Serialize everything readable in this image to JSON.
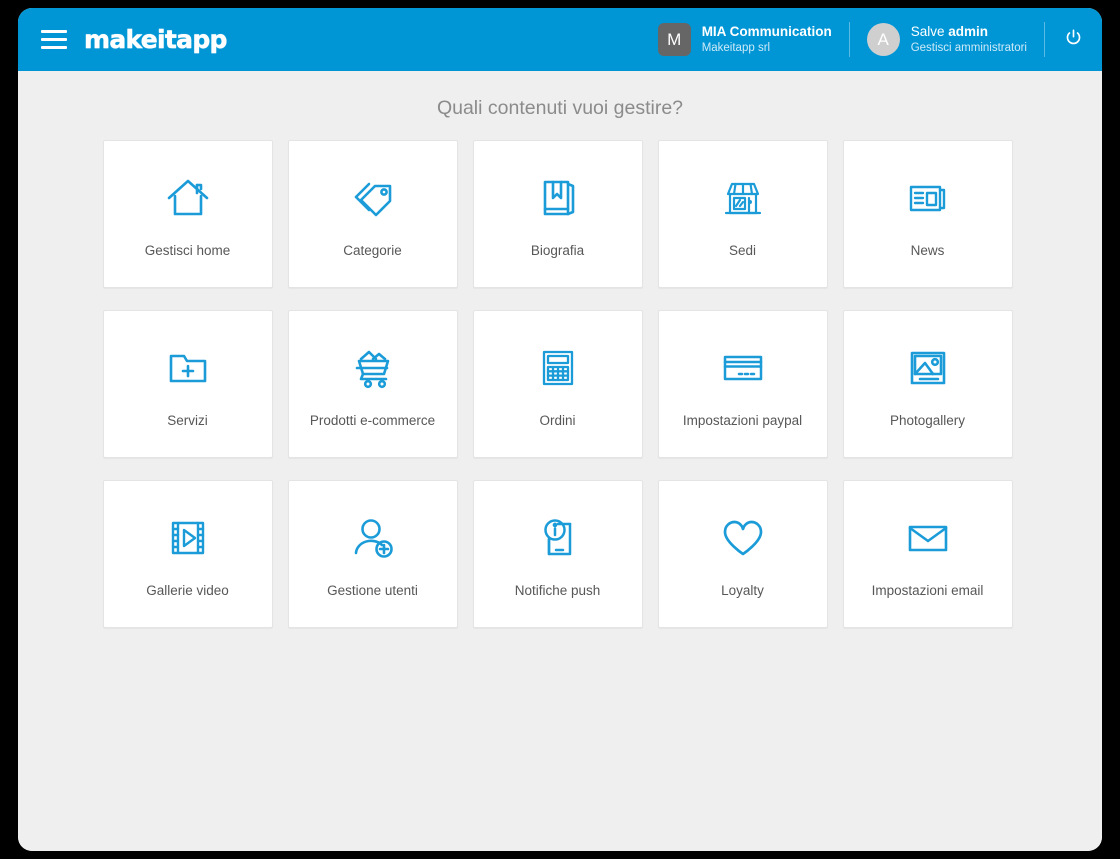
{
  "header": {
    "menu_icon": "hamburger-icon",
    "logo": "makeitapp",
    "company": {
      "avatar_initial": "M",
      "name": "MIA Communication",
      "subtitle": "Makeitapp srl"
    },
    "user": {
      "avatar_initial": "A",
      "greeting_prefix": "Salve ",
      "greeting_name": "admin",
      "subtitle": "Gestisci amministratori"
    },
    "power_icon": "power-icon",
    "accent_color": "#0096d6"
  },
  "main": {
    "title": "Quali contenuti vuoi gestire?",
    "tiles": [
      {
        "label": "Gestisci home",
        "icon": "house-icon"
      },
      {
        "label": "Categorie",
        "icon": "tags-icon"
      },
      {
        "label": "Biografia",
        "icon": "book-icon"
      },
      {
        "label": "Sedi",
        "icon": "storefront-icon"
      },
      {
        "label": "News",
        "icon": "newspaper-icon"
      },
      {
        "label": "Servizi",
        "icon": "folder-plus-icon"
      },
      {
        "label": "Prodotti e-commerce",
        "icon": "shopping-cart-icon"
      },
      {
        "label": "Ordini",
        "icon": "calculator-icon"
      },
      {
        "label": "Impostazioni paypal",
        "icon": "credit-card-icon"
      },
      {
        "label": "Photogallery",
        "icon": "image-icon"
      },
      {
        "label": "Gallerie video",
        "icon": "film-play-icon"
      },
      {
        "label": "Gestione utenti",
        "icon": "user-plus-icon"
      },
      {
        "label": "Notifiche push",
        "icon": "phone-info-icon"
      },
      {
        "label": "Loyalty",
        "icon": "heart-icon"
      },
      {
        "label": "Impostazioni email",
        "icon": "envelope-icon"
      }
    ]
  },
  "colors": {
    "header_blue": "#0096d6",
    "icon_blue": "#1b9cd8",
    "page_background": "#efefef",
    "tile_background": "#ffffff",
    "label_text": "#575757",
    "title_text": "#8b8b8b"
  }
}
